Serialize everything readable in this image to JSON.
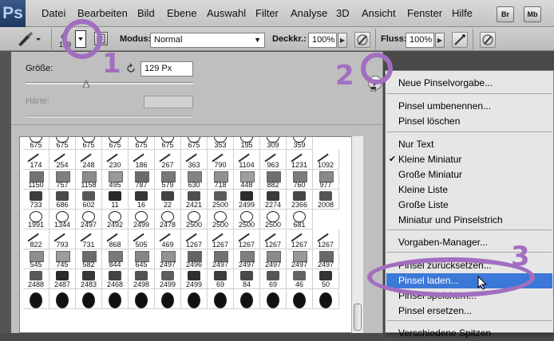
{
  "app": {
    "logo": "Ps"
  },
  "menubar": {
    "items": [
      "Datei",
      "Bearbeiten",
      "Bild",
      "Ebene",
      "Auswahl",
      "Filter",
      "Analyse",
      "3D",
      "Ansicht",
      "Fenster",
      "Hilfe"
    ],
    "br_label": "Br",
    "mb_label": "Mb"
  },
  "options": {
    "brush_size": "129",
    "mode_label": "Modus:",
    "mode_value": "Normal",
    "opacity_label": "Deckkr.:",
    "opacity_value": "100%",
    "flow_label": "Fluss:",
    "flow_value": "100%"
  },
  "picker": {
    "size_label": "Größe:",
    "size_value": "129 Px",
    "size_slider": 0.36,
    "hardness_label": "Härte:"
  },
  "brushes": {
    "rows": [
      [
        "675",
        "675",
        "675",
        "675",
        "675",
        "675",
        "675",
        "353",
        "195",
        "309",
        "359"
      ],
      [
        "174",
        "254",
        "248",
        "230",
        "186",
        "267",
        "363",
        "790",
        "1104",
        "963",
        "1231",
        "1092"
      ],
      [
        "1150",
        "757",
        "1158",
        "495",
        "787",
        "579",
        "630",
        "718",
        "448",
        "882",
        "760",
        "977"
      ],
      [
        "733",
        "686",
        "602",
        "11",
        "16",
        "22",
        "2421",
        "2500",
        "2499",
        "2274",
        "2366",
        "2008"
      ],
      [
        "1991",
        "1344",
        "2497",
        "2492",
        "2499",
        "2478",
        "2500",
        "2500",
        "2500",
        "2500",
        "681"
      ],
      [
        "822",
        "793",
        "731",
        "868",
        "505",
        "469",
        "1267",
        "1267",
        "1267",
        "1267",
        "1267",
        "1267"
      ],
      [
        "545",
        "745",
        "582",
        "844",
        "645",
        "2497",
        "2496",
        "2497",
        "2497",
        "2497",
        "2497",
        "2497"
      ],
      [
        "2488",
        "2487",
        "2483",
        "2468",
        "2498",
        "2499",
        "2499",
        "69",
        "84",
        "69",
        "46",
        "50"
      ],
      [
        "",
        "",
        "",
        "",
        "",
        "",
        "",
        "",
        "",
        "",
        "",
        ""
      ]
    ]
  },
  "dropdown": {
    "items": [
      {
        "label": "Neue Pinselvorgabe...",
        "checked": false
      },
      {
        "label": "Pinsel umbenennen...",
        "checked": false
      },
      {
        "label": "Pinsel löschen",
        "checked": false
      },
      {
        "label": "Nur Text",
        "checked": false
      },
      {
        "label": "Kleine Miniatur",
        "checked": true
      },
      {
        "label": "Große Miniatur",
        "checked": false
      },
      {
        "label": "Kleine Liste",
        "checked": false
      },
      {
        "label": "Große Liste",
        "checked": false
      },
      {
        "label": "Miniatur und Pinselstrich",
        "checked": false
      },
      {
        "label": "Vorgaben-Manager...",
        "checked": false
      },
      {
        "label": "Pinsel zurücksetzen...",
        "checked": false
      },
      {
        "label": "Pinsel laden...",
        "checked": false
      },
      {
        "label": "Pinsel speichern...",
        "checked": false
      },
      {
        "label": "Pinsel ersetzen...",
        "checked": false
      },
      {
        "label": "Verschiedene Spitzen",
        "checked": false
      }
    ]
  },
  "annotations": {
    "step1": "1",
    "step2": "2",
    "step3": "3"
  },
  "colors": {
    "accent": "#a26ec0",
    "highlight": "#3c78d8"
  }
}
